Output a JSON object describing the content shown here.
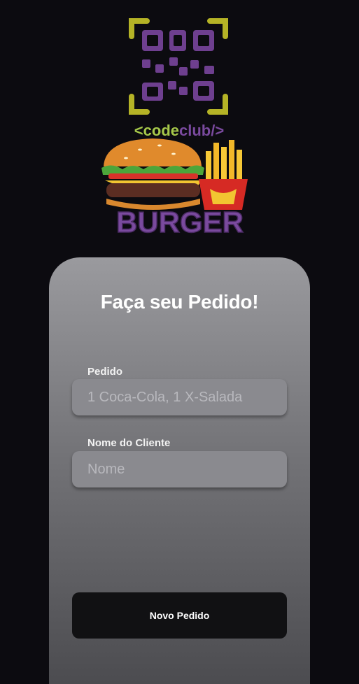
{
  "logo": {
    "brand_open": "<code",
    "brand_highlight": "club/>",
    "word": "BURGER"
  },
  "card": {
    "title": "Faça seu Pedido!",
    "order_label": "Pedido",
    "order_placeholder": "1 Coca-Cola, 1 X-Salada",
    "name_label": "Nome do Cliente",
    "name_placeholder": "Nome",
    "submit_label": "Novo Pedido"
  },
  "colors": {
    "background": "#0c0b10",
    "qr_purple": "#6e3f8f",
    "qr_frame": "#b5b326",
    "brand_green": "#a6c84a",
    "button": "#111113"
  }
}
